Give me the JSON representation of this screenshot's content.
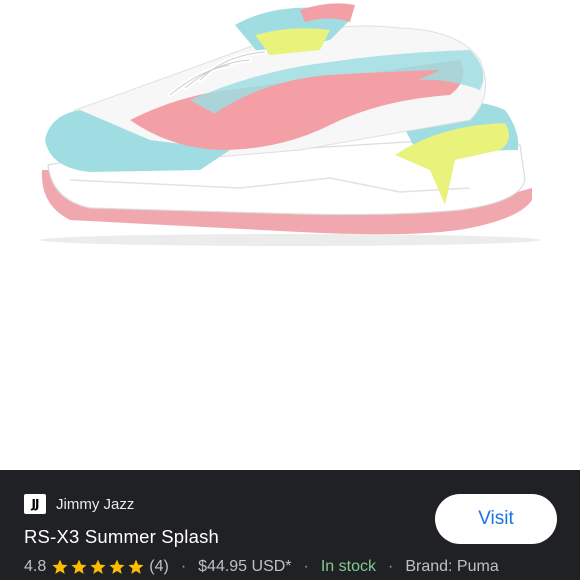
{
  "merchant": {
    "logo_text": "JJ",
    "name": "Jimmy Jazz"
  },
  "product": {
    "title": "RS-X3 Summer Splash",
    "rating": "4.8",
    "stars": 5,
    "review_count": "(4)",
    "price": "$44.95 USD*",
    "availability": "In stock",
    "brand": "Brand: Puma",
    "separator": "·"
  },
  "actions": {
    "visit_label": "Visit"
  },
  "colors": {
    "panel_bg": "#202124",
    "star": "#fbbc04",
    "in_stock": "#81c995",
    "visit_text": "#1a73e8",
    "shoe_blue": "#9fdde2",
    "shoe_pink": "#f2a0a6",
    "shoe_yellow": "#e9f27a",
    "sole_pink": "#f0a7ae"
  }
}
